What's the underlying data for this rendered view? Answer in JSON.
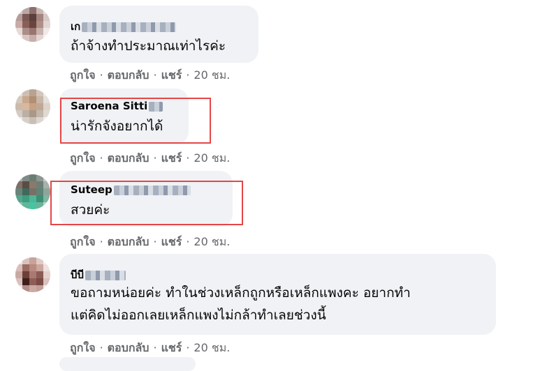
{
  "comments": [
    {
      "author": "เก",
      "text": "ถ้าจ้างทำประมาณเท่าไรค่ะ",
      "actions": {
        "like": "ถูกใจ",
        "reply": "ตอบกลับ",
        "share": "แชร์",
        "time": "20 ชม."
      }
    },
    {
      "author": "Saroena Sitti",
      "text": "น่ารักจังอยากได้",
      "actions": {
        "like": "ถูกใจ",
        "reply": "ตอบกลับ",
        "share": "แชร์",
        "time": "20 ชม."
      }
    },
    {
      "author": "Suteep",
      "text": "สวยค่ะ",
      "actions": {
        "like": "ถูกใจ",
        "reply": "ตอบกลับ",
        "share": "แชร์",
        "time": "20 ชม."
      }
    },
    {
      "author": "บีบี",
      "text_line1": "ขอถามหน่อยค่ะ ทำในช่วงเหล็กถูกหรือเหล็กแพงคะ อยากทำ",
      "text_line2": "แต่คิดไม่ออกเลยเหล็กแพงไม่กล้าทำเลยช่วงนี้",
      "actions": {
        "like": "ถูกใจ",
        "reply": "ตอบกลับ",
        "share": "แชร์",
        "time": "20 ชม."
      }
    }
  ],
  "colors": {
    "bubble": "#f0f2f5",
    "action_text": "#65676b",
    "highlight_box": "#e54646"
  }
}
